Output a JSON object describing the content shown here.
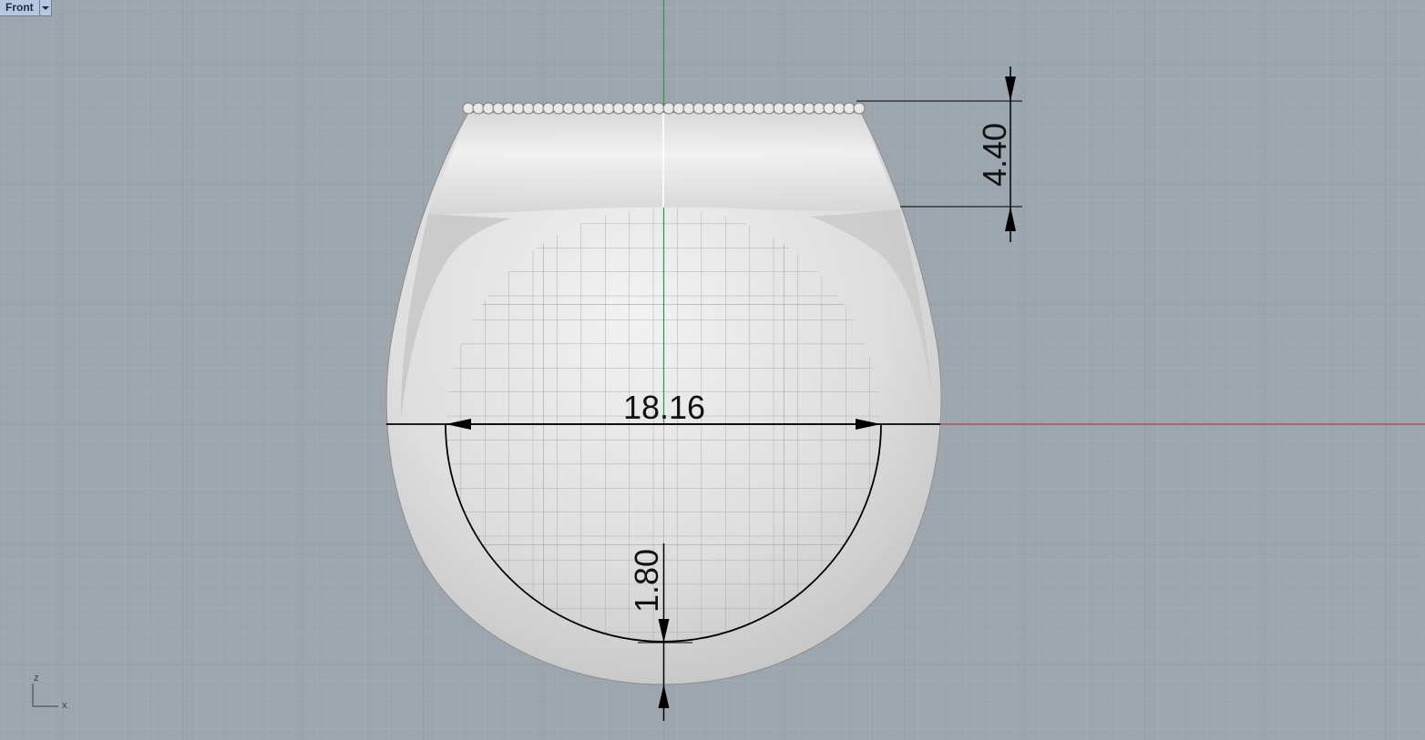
{
  "viewport": {
    "name": "Front",
    "dropdown_icon": "chevron-down-icon"
  },
  "dimensions": {
    "inner_diameter": "18.16",
    "top_height": "4.40",
    "shank_thickness": "1.80"
  },
  "axis_indicator": {
    "vertical": "z",
    "horizontal": "x"
  },
  "colors": {
    "background": "#9da6ae",
    "grid_minor": "#a5aeb6",
    "grid_major": "#8e979f",
    "x_axis": "#b04040",
    "z_axis": "#2e9a3e",
    "ring": "#dcdcdc",
    "dimension_line": "#000000"
  }
}
